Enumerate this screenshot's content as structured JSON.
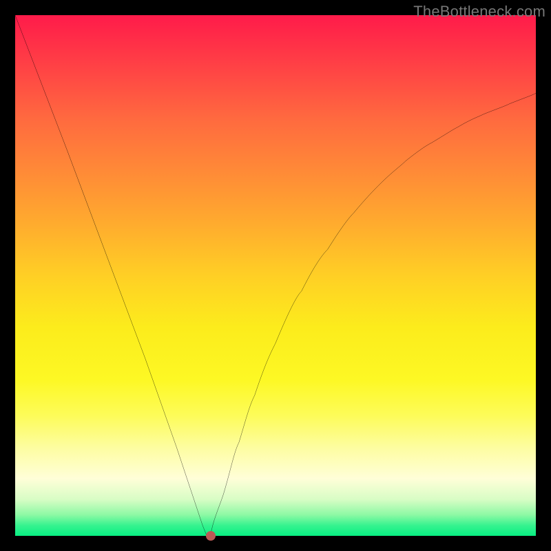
{
  "watermark": "TheBottleneck.com",
  "chart_data": {
    "type": "line",
    "title": "",
    "xlabel": "",
    "ylabel": "",
    "xlim": [
      0,
      100
    ],
    "ylim": [
      0,
      100
    ],
    "curve": {
      "x": [
        0,
        5,
        10,
        13,
        16,
        19,
        22,
        25,
        28,
        31,
        33,
        35,
        36,
        36.8,
        37.5,
        40,
        43,
        46,
        50,
        55,
        60,
        65,
        70,
        75,
        80,
        85,
        90,
        95,
        100
      ],
      "y": [
        100,
        87,
        74,
        66,
        58,
        50,
        42,
        34,
        25.5,
        17,
        11,
        5,
        2,
        0,
        0,
        8,
        18,
        27,
        37,
        47,
        55,
        62,
        67.5,
        72,
        75.5,
        78.5,
        81,
        83,
        85
      ]
    },
    "annotation_point": {
      "x": 37.5,
      "y": 0
    },
    "gradient": {
      "top_color": "#ff1b4a",
      "mid_color": "#ffcf25",
      "bottom_color": "#07ee82"
    }
  }
}
